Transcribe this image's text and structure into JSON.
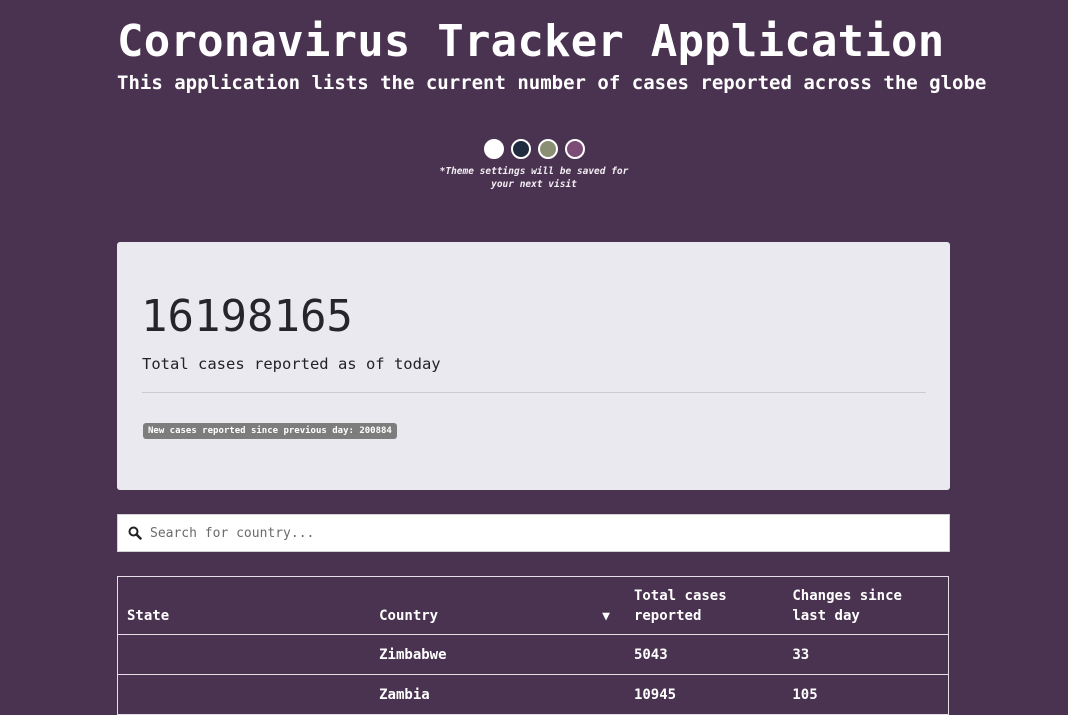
{
  "header": {
    "title": "Coronavirus Tracker Application",
    "subtitle": "This application lists the current number of cases reported across the globe"
  },
  "theme": {
    "options": [
      {
        "name": "white",
        "color": "#ffffff"
      },
      {
        "name": "navy",
        "color": "#1f2b3e"
      },
      {
        "name": "olive",
        "color": "#8a8f73"
      },
      {
        "name": "purple",
        "color": "#7c4c77"
      }
    ],
    "note": "*Theme settings will be saved for your next visit"
  },
  "summary": {
    "total_cases": "16198165",
    "total_label": "Total cases reported as of today",
    "new_cases_badge": "New cases reported since previous day: 200884"
  },
  "search": {
    "placeholder": "Search for country...",
    "value": "",
    "icon": "search-icon"
  },
  "table": {
    "headers": {
      "state": "State",
      "country": "Country",
      "total": "Total cases reported",
      "change": "Changes since last day"
    },
    "sort_indicator": "▼",
    "rows": [
      {
        "state": "",
        "country": "Zimbabwe",
        "total": "5043",
        "change": "33"
      },
      {
        "state": "",
        "country": "Zambia",
        "total": "10945",
        "change": "105"
      }
    ]
  },
  "colors": {
    "background": "#4a3350",
    "card": "#e9e9ef",
    "badge": "#7d7d7e"
  }
}
